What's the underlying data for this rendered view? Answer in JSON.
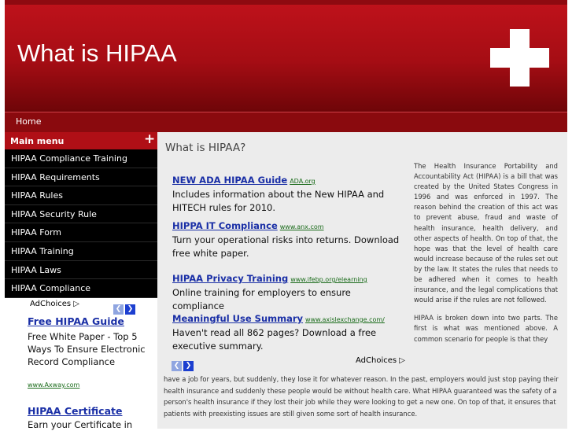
{
  "header": {
    "title": "What is HIPAA"
  },
  "nav": {
    "home": "Home"
  },
  "sidebar": {
    "menu_title": "Main menu",
    "plus": "+",
    "items": [
      "HIPAA Compliance Training",
      "HIPAA Requirements",
      "HIPAA Rules",
      "HIPAA Security Rule",
      "HIPAA Form",
      "HIPAA Training",
      "HIPAA Laws",
      "HIPAA Compliance"
    ],
    "adchoices": "AdChoices ▷",
    "ads": [
      {
        "title": "Free HIPAA Guide",
        "text": "Free White Paper - Top 5 Ways To Ensure Electronic Record Compliance",
        "url": "www.Axway.com"
      },
      {
        "title": "HIPAA Certificate",
        "text": "Earn your Certificate in"
      }
    ]
  },
  "content": {
    "heading": "What is HIPAA?",
    "ads": [
      {
        "title": "NEW ADA HIPAA Guide",
        "url": "ADA.org",
        "text": "Includes information about the New HIPAA and HITECH rules for 2010."
      },
      {
        "title": "HIPPA IT Compliance",
        "url": "www.anx.com",
        "text": "Turn your operational risks into returns. Download free white paper."
      },
      {
        "title": "HIPAA Privacy Training",
        "url": "www.ifebp.org/elearning",
        "text": "Online training for employers to ensure compliance"
      },
      {
        "title": "Meaningful Use Summary",
        "url": "www.axislexchange.com/",
        "text": "Haven't read all 862 pages? Download a free executive summary."
      }
    ],
    "adchoices": "AdChoices ▷",
    "article": {
      "p1": "The Health Insurance Portability and Accountability Act (HIPAA) is a bill that was created by the United States Congress in 1996 and was enforced in 1997. The reason behind the creation of this act was to prevent abuse, fraud and waste of health insurance, health delivery, and other aspects of health. On top of that, the hope was that the level of health care would increase because of the rules set out by the law. It states the rules that needs to be adhered when it comes to health insurance, and the legal complications that would arise if the rules are not followed.",
      "p2": "HIPAA is broken down into two parts. The first is what was mentioned above. A common scenario for people is that they",
      "p2_cont": "have a job for years, but suddenly, they lose it for whatever reason. In the past, employers would just stop paying their health insurance and suddenly these people would be without health care. What HIPAA guaranteed was the safety of a person's health insurance if they lost their job while they were looking to get a new one. On top of that, it ensures that patients with preexisting issues are still given some sort of health insurance."
    }
  },
  "colors": {
    "brand_red": "#b00f16",
    "link_blue": "#1a2fa6",
    "url_green": "#1a6b1a"
  }
}
